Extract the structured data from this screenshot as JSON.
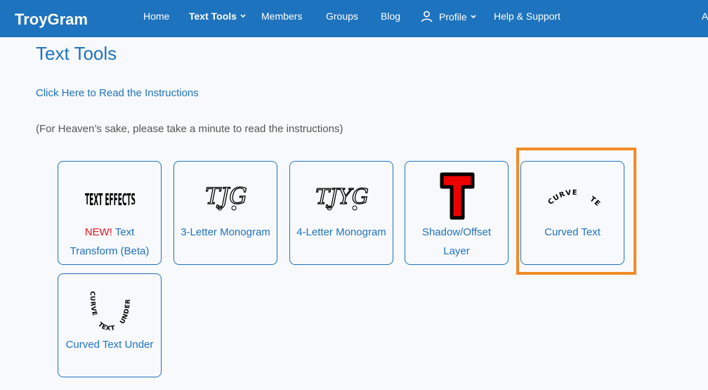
{
  "navbar": {
    "brand": "TroyGram",
    "items": [
      {
        "label": "Home"
      },
      {
        "label": "Text Tools"
      },
      {
        "label": "Members"
      },
      {
        "label": "Groups"
      },
      {
        "label": "Blog"
      },
      {
        "label": "Profile"
      },
      {
        "label": "Help & Support"
      }
    ],
    "cut_off_text": "A"
  },
  "main": {
    "title": "Text Tools",
    "instructions_link": "Click Here to Read the Instructions",
    "note": "(For Heaven’s sake, please take a minute to read the instructions)"
  },
  "tools": [
    {
      "badge": "NEW!",
      "label": " Text Transform (Beta)",
      "icon": "text-effects-icon"
    },
    {
      "label": "3-Letter Monogram",
      "icon": "monogram-3-icon",
      "icon_text": "TJG"
    },
    {
      "label": "4-Letter Monogram",
      "icon": "monogram-4-icon",
      "icon_text": "TJYG"
    },
    {
      "label": "Shadow/Offset Layer",
      "icon": "shadow-t-icon",
      "icon_text": "T"
    },
    {
      "label": "Curved Text",
      "icon": "curve-text-icon"
    },
    {
      "label": "Curved Text Under",
      "icon": "curve-under-icon"
    }
  ],
  "icon_texts": {
    "text_effects": "TEXT EFFECTS",
    "curve_top_1": "CURVE",
    "curve_top_2": "TEXT",
    "curve_under_1": "CURVE",
    "curve_under_2": "TEXT",
    "curve_under_3": "UNDER"
  },
  "colors": {
    "brand_blue": "#1e73be",
    "new_red": "#e8141d",
    "highlight_orange": "#f28b26",
    "shadow_red": "#ee0000"
  }
}
